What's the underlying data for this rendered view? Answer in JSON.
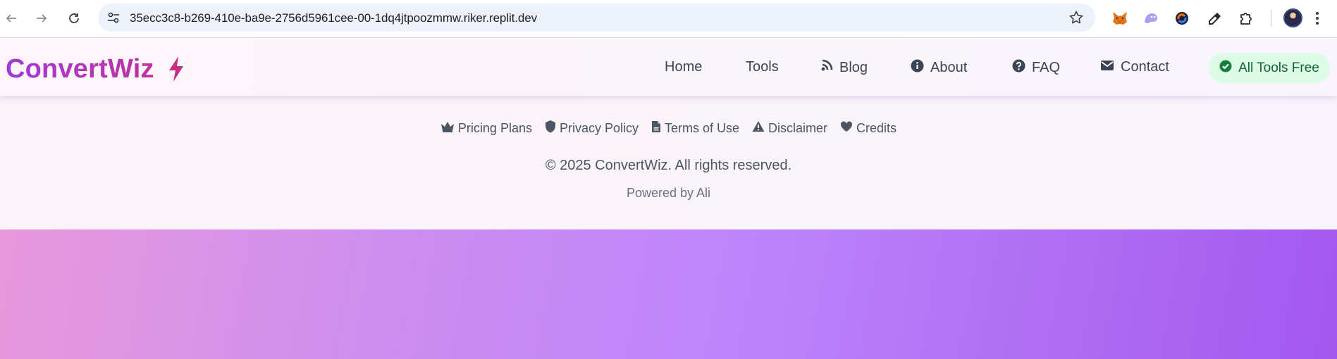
{
  "browser": {
    "url": "35ecc3c8-b269-410e-ba9e-2756d5961cee-00-1dq4jtpoozmmw.riker.replit.dev",
    "nav_icons": [
      "back-arrow-icon",
      "forward-arrow-icon",
      "reload-icon"
    ],
    "extensions": [
      "metamask-fox-icon",
      "ghost-wallet-icon",
      "sync-circle-icon",
      "eyedropper-icon",
      "puzzle-extensions-icon"
    ]
  },
  "header": {
    "brand": "ConvertWiz",
    "nav": [
      {
        "label": "Home",
        "icon": ""
      },
      {
        "label": "Tools",
        "icon": ""
      },
      {
        "label": "Blog",
        "icon": "blog-icon"
      },
      {
        "label": "About",
        "icon": "info-circle-icon"
      },
      {
        "label": "FAQ",
        "icon": "question-circle-icon"
      },
      {
        "label": "Contact",
        "icon": "envelope-icon"
      }
    ],
    "badge": "All Tools Free",
    "colors": {
      "brand_start": "#a13ad6",
      "brand_end": "#c0329f",
      "badge_bg": "#dcfce7",
      "badge_text": "#166534"
    }
  },
  "footer": {
    "links": [
      {
        "label": "Pricing Plans",
        "icon": "crown-icon"
      },
      {
        "label": "Privacy Policy",
        "icon": "shield-icon"
      },
      {
        "label": "Terms of Use",
        "icon": "document-icon"
      },
      {
        "label": "Disclaimer",
        "icon": "warning-triangle-icon"
      },
      {
        "label": "Credits",
        "icon": "heart-icon"
      }
    ],
    "copyright": "© 2025 ConvertWiz. All rights reserved.",
    "powered_by": "Powered by Ali"
  },
  "hero": {
    "gradient_start": "#e799dc",
    "gradient_end": "#a457ee"
  }
}
